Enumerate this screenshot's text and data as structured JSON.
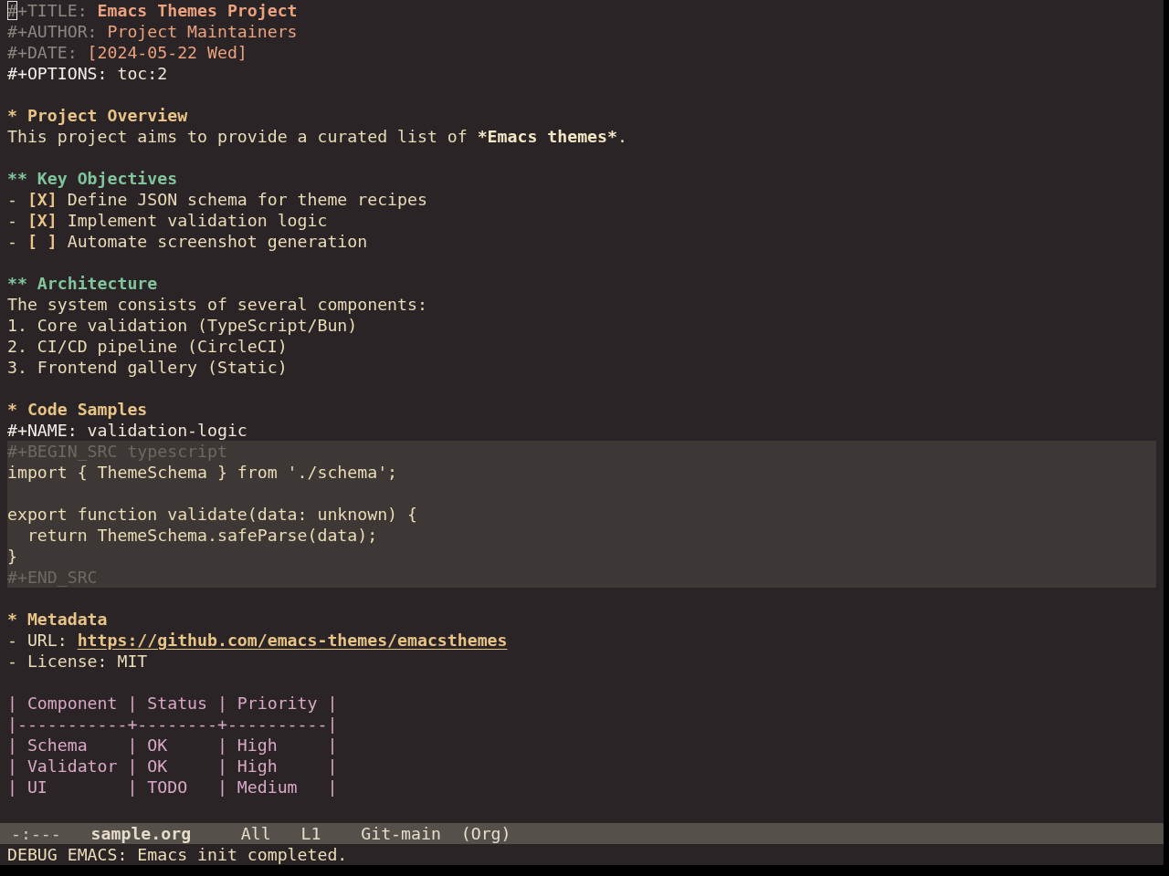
{
  "buffer": {
    "lines": [
      {
        "kind": "title",
        "key": "#+TITLE:",
        "value": "Emacs Themes Project",
        "cursor": true
      },
      {
        "kind": "meta",
        "key": "#+AUTHOR:",
        "value": "Project Maintainers"
      },
      {
        "kind": "meta",
        "key": "#+DATE:",
        "value": "[2024-05-22 Wed]"
      },
      {
        "kind": "setting",
        "key": "#+OPTIONS:",
        "value": "toc:2"
      },
      {
        "kind": "blank"
      },
      {
        "kind": "heading",
        "marker": "*",
        "title": "Project Overview"
      },
      {
        "kind": "text",
        "parts": [
          {
            "text": "This project aims to provide a curated list of ",
            "bold": false
          },
          {
            "text": "*Emacs themes*",
            "bold": true
          },
          {
            "text": ".",
            "bold": false
          }
        ]
      },
      {
        "kind": "blank"
      },
      {
        "kind": "subheading",
        "marker": "**",
        "title": "Key Objectives"
      },
      {
        "kind": "checkbox",
        "bullet": "-",
        "box": "[X]",
        "text": "Define JSON schema for theme recipes"
      },
      {
        "kind": "checkbox",
        "bullet": "-",
        "box": "[X]",
        "text": "Implement validation logic"
      },
      {
        "kind": "checkbox",
        "bullet": "-",
        "box": "[ ]",
        "text": "Automate screenshot generation"
      },
      {
        "kind": "blank"
      },
      {
        "kind": "subheading",
        "marker": "**",
        "title": "Architecture"
      },
      {
        "kind": "text",
        "parts": [
          {
            "text": "The system consists of several components:",
            "bold": false
          }
        ]
      },
      {
        "kind": "list",
        "text": "1. Core validation (TypeScript/Bun)"
      },
      {
        "kind": "list",
        "text": "2. CI/CD pipeline (CircleCI)"
      },
      {
        "kind": "list",
        "text": "3. Frontend gallery (Static)"
      },
      {
        "kind": "blank"
      },
      {
        "kind": "heading",
        "marker": "*",
        "title": "Code Samples"
      },
      {
        "kind": "setting",
        "key": "#+NAME:",
        "value": "validation-logic"
      },
      {
        "kind": "src_block",
        "begin": "#+BEGIN_SRC typescript",
        "code": [
          {
            "kind": "code",
            "text": "import { ThemeSchema } from './schema';"
          },
          {
            "kind": "blank"
          },
          {
            "kind": "code",
            "text": "export function validate(data: unknown) {"
          },
          {
            "kind": "code",
            "text": "  return ThemeSchema.safeParse(data);"
          },
          {
            "kind": "code",
            "text": "}"
          }
        ],
        "end": "#+END_SRC"
      },
      {
        "kind": "blank"
      },
      {
        "kind": "heading",
        "marker": "*",
        "title": "Metadata"
      },
      {
        "kind": "link",
        "label": "- URL:",
        "url": "https://github.com/emacs-themes/emacsthemes"
      },
      {
        "kind": "list",
        "text": "- License: MIT"
      },
      {
        "kind": "blank"
      },
      {
        "kind": "table",
        "header": "| Component | Status | Priority |",
        "rule": "|-----------+--------+----------|",
        "rows": [
          "| Schema    | OK     | High     |",
          "| Validator | OK     | High     |",
          "| UI        | TODO   | Medium   |"
        ]
      }
    ]
  },
  "mode_line": {
    "status": "-:---",
    "buffer_name": "sample.org",
    "position": "All",
    "line": "L1",
    "vc": "Git-main",
    "mode": "(Org)"
  },
  "echo_area": {
    "message": "DEBUG EMACS: Emacs init completed."
  }
}
